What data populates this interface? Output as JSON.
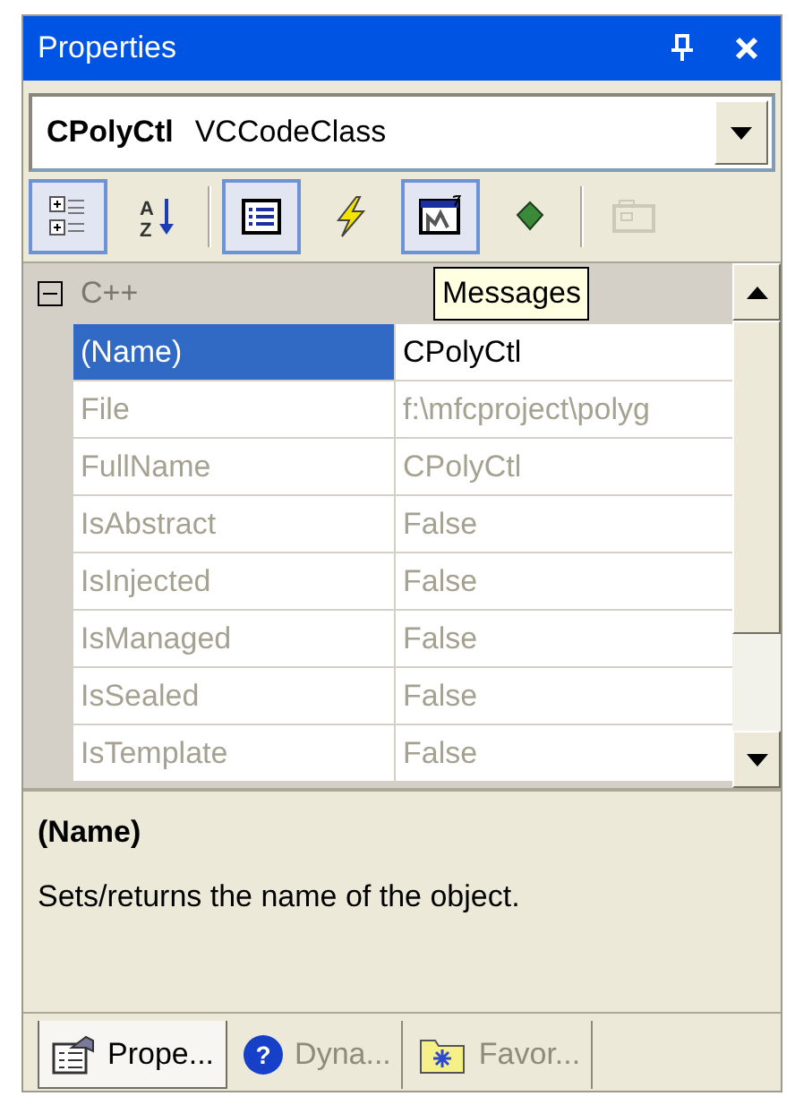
{
  "window": {
    "title": "Properties"
  },
  "object_selector": {
    "name": "CPolyCtl",
    "type": "VCCodeClass"
  },
  "toolbar": [
    {
      "kind": "categorized",
      "pressed": true,
      "disabled": false
    },
    {
      "kind": "alphabetical",
      "pressed": false,
      "disabled": false,
      "icon_letters": [
        "A",
        "Z"
      ]
    },
    {
      "kind": "separator"
    },
    {
      "kind": "properties",
      "pressed": true,
      "disabled": false
    },
    {
      "kind": "events",
      "pressed": false,
      "disabled": false
    },
    {
      "kind": "messages",
      "pressed": true,
      "disabled": false
    },
    {
      "kind": "overrides",
      "pressed": false,
      "disabled": false
    },
    {
      "kind": "separator"
    },
    {
      "kind": "property_pages",
      "pressed": false,
      "disabled": true
    }
  ],
  "tooltip": "Messages",
  "grid": {
    "category": {
      "label": "C++",
      "expanded": true
    },
    "rows": [
      {
        "name": "(Name)",
        "value": "CPolyCtl",
        "selected": true,
        "disabled": false
      },
      {
        "name": "File",
        "value": "f:\\mfcproject\\polyg",
        "selected": false,
        "disabled": true
      },
      {
        "name": "FullName",
        "value": "CPolyCtl",
        "selected": false,
        "disabled": true
      },
      {
        "name": "IsAbstract",
        "value": "False",
        "selected": false,
        "disabled": true
      },
      {
        "name": "IsInjected",
        "value": "False",
        "selected": false,
        "disabled": true
      },
      {
        "name": "IsManaged",
        "value": "False",
        "selected": false,
        "disabled": true
      },
      {
        "name": "IsSealed",
        "value": "False",
        "selected": false,
        "disabled": true
      },
      {
        "name": "IsTemplate",
        "value": "False",
        "selected": false,
        "disabled": true
      }
    ]
  },
  "description": {
    "title": "(Name)",
    "text": "Sets/returns the name of the object."
  },
  "tabs": [
    {
      "kind": "properties",
      "label": "Prope...",
      "selected": true
    },
    {
      "kind": "help",
      "label": "Dyna...",
      "selected": false,
      "icon_glyph": "?"
    },
    {
      "kind": "favorites",
      "label": "Favor...",
      "selected": false
    }
  ]
}
